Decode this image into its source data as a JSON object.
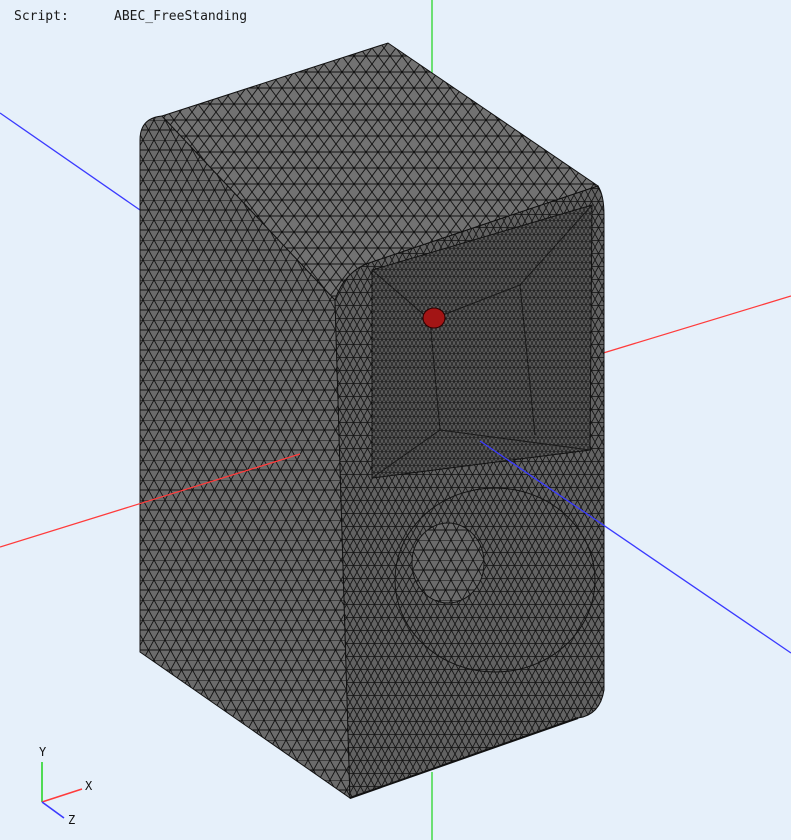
{
  "header": {
    "script_key": "Script:",
    "script_value": "ABEC_FreeStanding"
  },
  "triad": {
    "x_label": "X",
    "y_label": "Y",
    "z_label": "Z"
  },
  "colors": {
    "background": "#e6f0fa",
    "x_axis": "#ff3b3b",
    "y_axis": "#2bd62b",
    "z_axis": "#3a3aff",
    "mesh_fill": "#6a6a6a",
    "mesh_lines": "#111111",
    "source_highlight": "#a31515"
  },
  "icons": {
    "mesh": "speaker-cabinet-mesh",
    "source": "driver-source-patch"
  }
}
